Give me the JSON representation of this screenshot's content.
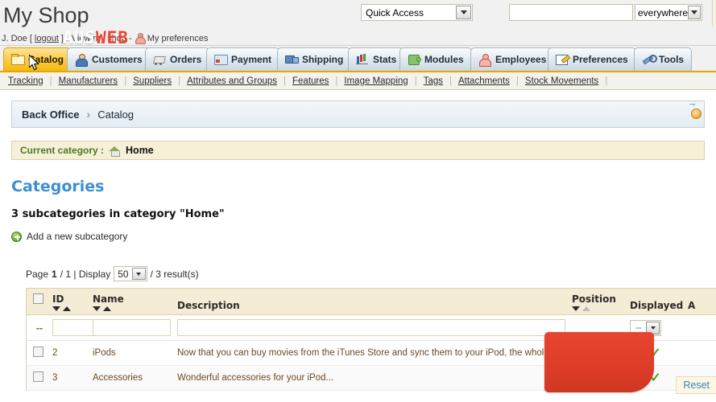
{
  "header": {
    "shop_title": "My Shop",
    "user_prefix": "J. Doe [",
    "logout_label": "logout",
    "user_mid": "] - View my shop -",
    "preferences_label": "My preferences",
    "quick_access_value": "Quick Access",
    "search_value": "",
    "search_scope_value": "everywhere"
  },
  "tabs": [
    {
      "label": "Catalog",
      "icon": "folder-icon",
      "active": true
    },
    {
      "label": "Customers",
      "icon": "customer-icon",
      "active": false
    },
    {
      "label": "Orders",
      "icon": "cart-icon",
      "active": false
    },
    {
      "label": "Payment",
      "icon": "payment-icon",
      "active": false
    },
    {
      "label": "Shipping",
      "icon": "truck-icon",
      "active": false
    },
    {
      "label": "Stats",
      "icon": "chart-icon",
      "active": false
    },
    {
      "label": "Modules",
      "icon": "puzzle-icon",
      "active": false
    },
    {
      "label": "Employees",
      "icon": "employee-icon",
      "active": false
    },
    {
      "label": "Preferences",
      "icon": "edit-icon",
      "active": false
    },
    {
      "label": "Tools",
      "icon": "wrench-icon",
      "active": false
    }
  ],
  "subnav": [
    "Tracking",
    "Manufacturers",
    "Suppliers",
    "Attributes and Groups",
    "Features",
    "Image Mapping",
    "Tags",
    "Attachments",
    "Stock Movements"
  ],
  "breadcrumb": {
    "root": "Back Office",
    "separator": "›",
    "current": "Catalog"
  },
  "current_category": {
    "label": "Current category :",
    "name": "Home",
    "icon": "home-icon"
  },
  "categories_section": {
    "title": "Categories",
    "subcount": "3 subcategories in category \"Home\"",
    "add_label": "Add a new subcategory"
  },
  "pager": {
    "page_prefix": "Page",
    "page_number": "1",
    "page_total": "/ 1 | Display",
    "display_value": "50",
    "results": "/ 3 result(s)",
    "reset_label": "Reset"
  },
  "table": {
    "columns": {
      "id": "ID",
      "name": "Name",
      "description": "Description",
      "position": "Position",
      "displayed": "Displayed",
      "actions": "A"
    },
    "filter_row": {
      "dash": "--",
      "id_value": "",
      "name_value": "",
      "description_value": "",
      "displayed_value": "--"
    },
    "rows": [
      {
        "id": "2",
        "name": "iPods",
        "description": "Now that you can buy movies from the iTunes Store and sync them to your iPod, the whole wo...",
        "displayed": "✓"
      },
      {
        "id": "3",
        "name": "Accessories",
        "description": "Wonderful accessories for your iPod...",
        "displayed": "✓"
      }
    ]
  },
  "watermark": {
    "text_left": "AUS",
    "text_right": "WEB"
  },
  "colors": {
    "accent_orange": "#e8a400",
    "active_tab": "#fcc93f",
    "heading_blue": "#3d8fd3",
    "category_green": "#4b7a21",
    "watermark_red": "#e8452e",
    "row_text_brown": "#6b4a1f",
    "table_header_bg": "#f5ecd5"
  }
}
